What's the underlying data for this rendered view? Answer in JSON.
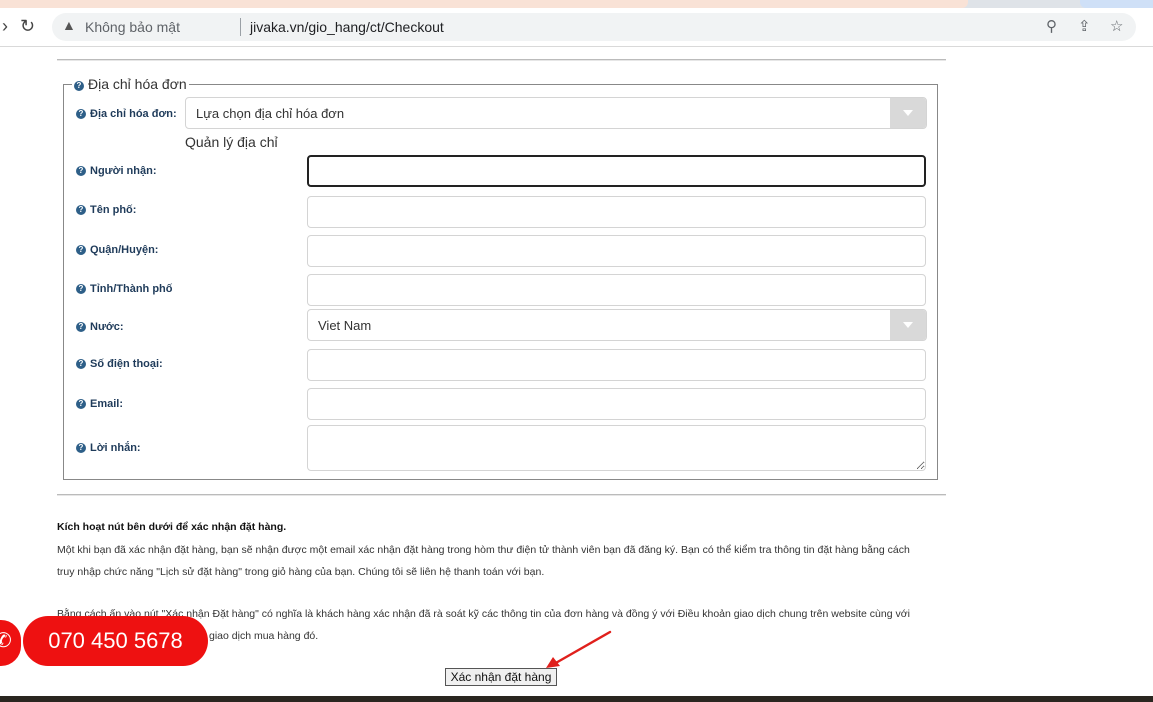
{
  "browser": {
    "back_icon": "arrow-left-icon",
    "reload_icon": "reload-icon",
    "security_label": "Không bảo mật",
    "url": "jivaka.vn/gio_hang/ct/Checkout",
    "icons": [
      "warning-icon",
      "zoom-icon",
      "share-icon",
      "star-icon"
    ]
  },
  "form": {
    "legend": "Địa chỉ hóa đơn",
    "billing_address_label": "Địa chỉ hóa đơn:",
    "billing_address_select": "Lựa chọn địa chỉ hóa đơn",
    "manage_address_link": "Quản lý địa chỉ",
    "recipient_label": "Người nhận:",
    "recipient_value": "",
    "street_label": "Tên phố:",
    "street_value": "",
    "district_label": "Quận/Huyện:",
    "district_value": "",
    "province_label": "Tỉnh/Thành phố",
    "province_value": "",
    "country_label": "Nước:",
    "country_value": "Viet Nam",
    "phone_label": "Số điện thoại:",
    "phone_value": "",
    "email_label": "Email:",
    "email_value": "",
    "message_label": "Lời nhắn:",
    "message_value": ""
  },
  "notice": {
    "heading": "Kích hoạt nút bên dưới để xác nhận đặt hàng.",
    "line1": "Một khi bạn đã xác nhận đặt hàng, bạn sẽ nhận được một email xác nhận đặt hàng trong hòm thư điện tử thành viên bạn đã đăng ký. Bạn có thể kiểm tra thông tin đặt hàng bằng cách",
    "line2": "truy nhập chức năng \"Lịch sử đặt hàng\" trong giỏ hàng của bạn. Chúng tôi sẽ liên hệ thanh toán với bạn.",
    "line3": "Bằng cách ấn vào nút \"Xác nhận Đặt hàng\" có nghĩa là khách hàng xác nhận đã rà soát kỹ các thông tin của đơn hàng và đồng ý với Điều khoản giao dịch chung trên website cùng với",
    "line4": "giao dịch mua hàng đó."
  },
  "confirm_button": "Xác nhận đặt hàng",
  "hotline": {
    "number": "070 450 5678",
    "icon": "phone-icon",
    "color": "#ee1111"
  }
}
